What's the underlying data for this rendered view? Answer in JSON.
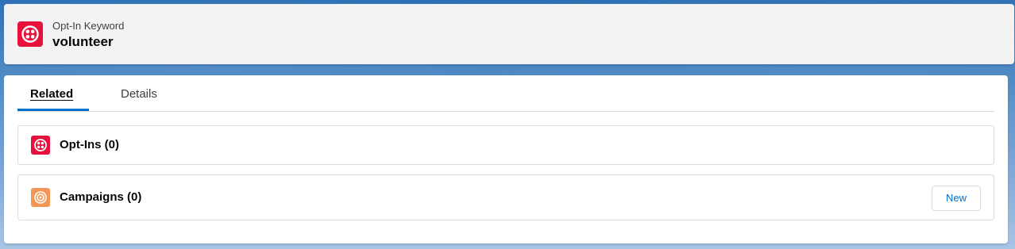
{
  "header": {
    "record_type": "Opt-In Keyword",
    "record_name": "volunteer",
    "icon": "twilio-icon",
    "icon_color": "#e8113c"
  },
  "tabs": [
    {
      "label": "Related",
      "active": true
    },
    {
      "label": "Details",
      "active": false
    }
  ],
  "related_lists": {
    "optins": {
      "title": "Opt-Ins (0)",
      "icon": "twilio-icon",
      "icon_color": "#e8113c"
    },
    "campaigns": {
      "title": "Campaigns (0)",
      "icon": "campaign-target-icon",
      "icon_color": "#f49756",
      "new_label": "New"
    }
  },
  "colors": {
    "accent": "#0070d2",
    "background_top": "#2e6fb4"
  }
}
